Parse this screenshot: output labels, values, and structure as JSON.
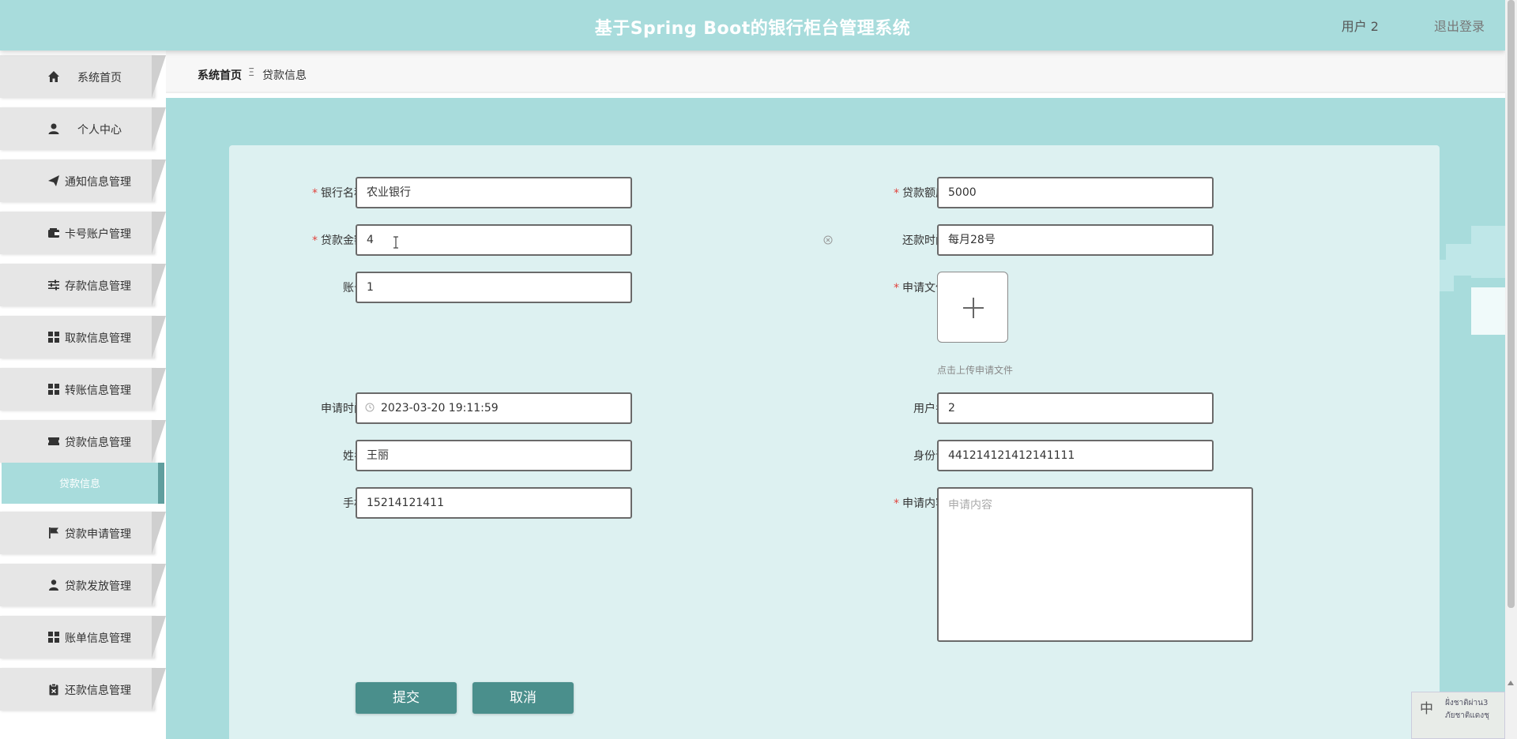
{
  "header": {
    "title": "基于Spring Boot的银行柜台管理系统",
    "user_label": "用户 2",
    "logout_label": "退出登录"
  },
  "sidebar": {
    "items": [
      {
        "label": "系统首页",
        "icon": "home-icon"
      },
      {
        "label": "个人中心",
        "icon": "user-icon"
      },
      {
        "label": "通知信息管理",
        "icon": "paper-plane-icon"
      },
      {
        "label": "卡号账户管理",
        "icon": "wallet-icon"
      },
      {
        "label": "存款信息管理",
        "icon": "sliders-icon"
      },
      {
        "label": "取款信息管理",
        "icon": "grid-icon"
      },
      {
        "label": "转账信息管理",
        "icon": "grid-icon"
      },
      {
        "label": "贷款信息管理",
        "icon": "ticket-icon"
      },
      {
        "label": "贷款申请管理",
        "icon": "flag-icon"
      },
      {
        "label": "贷款发放管理",
        "icon": "person-icon"
      },
      {
        "label": "账单信息管理",
        "icon": "grid-icon"
      },
      {
        "label": "还款信息管理",
        "icon": "clipboard-icon"
      }
    ],
    "active_sub": "贷款信息"
  },
  "breadcrumb": {
    "home": "系统首页",
    "separator": "Ξ",
    "current": "贷款信息"
  },
  "form": {
    "bank_name": {
      "label": "银行名称",
      "value": "农业银行",
      "required": true
    },
    "loan_limit": {
      "label": "贷款额度",
      "value": "5000",
      "required": true
    },
    "loan_amount": {
      "label": "贷款金额",
      "value": "4",
      "required": true
    },
    "repay_time": {
      "label": "还款时间",
      "value": "每月28号",
      "required": false
    },
    "account": {
      "label": "账号",
      "value": "1",
      "required": false
    },
    "apply_file": {
      "label": "申请文件",
      "hint": "点击上传申请文件",
      "required": true
    },
    "apply_time": {
      "label": "申请时间",
      "value": "2023-03-20 19:11:59",
      "required": false
    },
    "username": {
      "label": "用户名",
      "value": "2",
      "required": false
    },
    "name": {
      "label": "姓名",
      "value": "王丽",
      "required": false
    },
    "id_card": {
      "label": "身份证",
      "value": "441214121412141111",
      "required": false
    },
    "phone": {
      "label": "手机",
      "value": "15214121411",
      "required": false
    },
    "apply_content": {
      "label": "申请内容",
      "placeholder": "申请内容",
      "required": true
    }
  },
  "buttons": {
    "submit": "提交",
    "cancel": "取消"
  },
  "ime": {
    "zh": "中",
    "line1": "ฝั่งชาติผ่าน3",
    "line2": "ภัยชาติแดงชุ"
  },
  "colors": {
    "header_bg": "#a8dcdc",
    "accent": "#4a8f8c",
    "panel_bg": "#ddf1f1",
    "required": "#e0443e"
  }
}
